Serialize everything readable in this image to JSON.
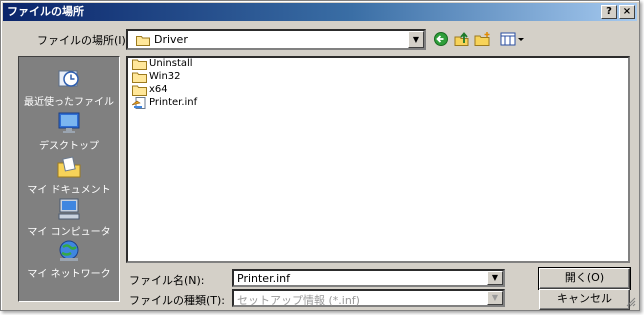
{
  "titlebar": {
    "title": "ファイルの場所",
    "help_label": "?",
    "close_label": "×"
  },
  "lookin": {
    "label": "ファイルの場所(I):",
    "value": "Driver"
  },
  "places": [
    {
      "label": "最近使ったファイル",
      "icon": "recent-icon"
    },
    {
      "label": "デスクトップ",
      "icon": "desktop-icon"
    },
    {
      "label": "マイ ドキュメント",
      "icon": "my-documents-icon"
    },
    {
      "label": "マイ コンピュータ",
      "icon": "my-computer-icon"
    },
    {
      "label": "マイ ネットワーク",
      "icon": "my-network-icon"
    }
  ],
  "files": [
    {
      "name": "Uninstall",
      "type": "folder"
    },
    {
      "name": "Win32",
      "type": "folder"
    },
    {
      "name": "x64",
      "type": "folder"
    },
    {
      "name": "Printer.inf",
      "type": "inf"
    }
  ],
  "filename": {
    "label": "ファイル名(N):",
    "value": "Printer.inf"
  },
  "filetype": {
    "label": "ファイルの種類(T):",
    "value": "セットアップ情報 (*.inf)"
  },
  "buttons": {
    "open_label": "開く(O)",
    "cancel_label": "キャンセル"
  },
  "colors": {
    "titlebar_start": "#0a246a",
    "titlebar_end": "#a6caf0",
    "places_bg": "#808080",
    "face": "#d4d0c8"
  }
}
